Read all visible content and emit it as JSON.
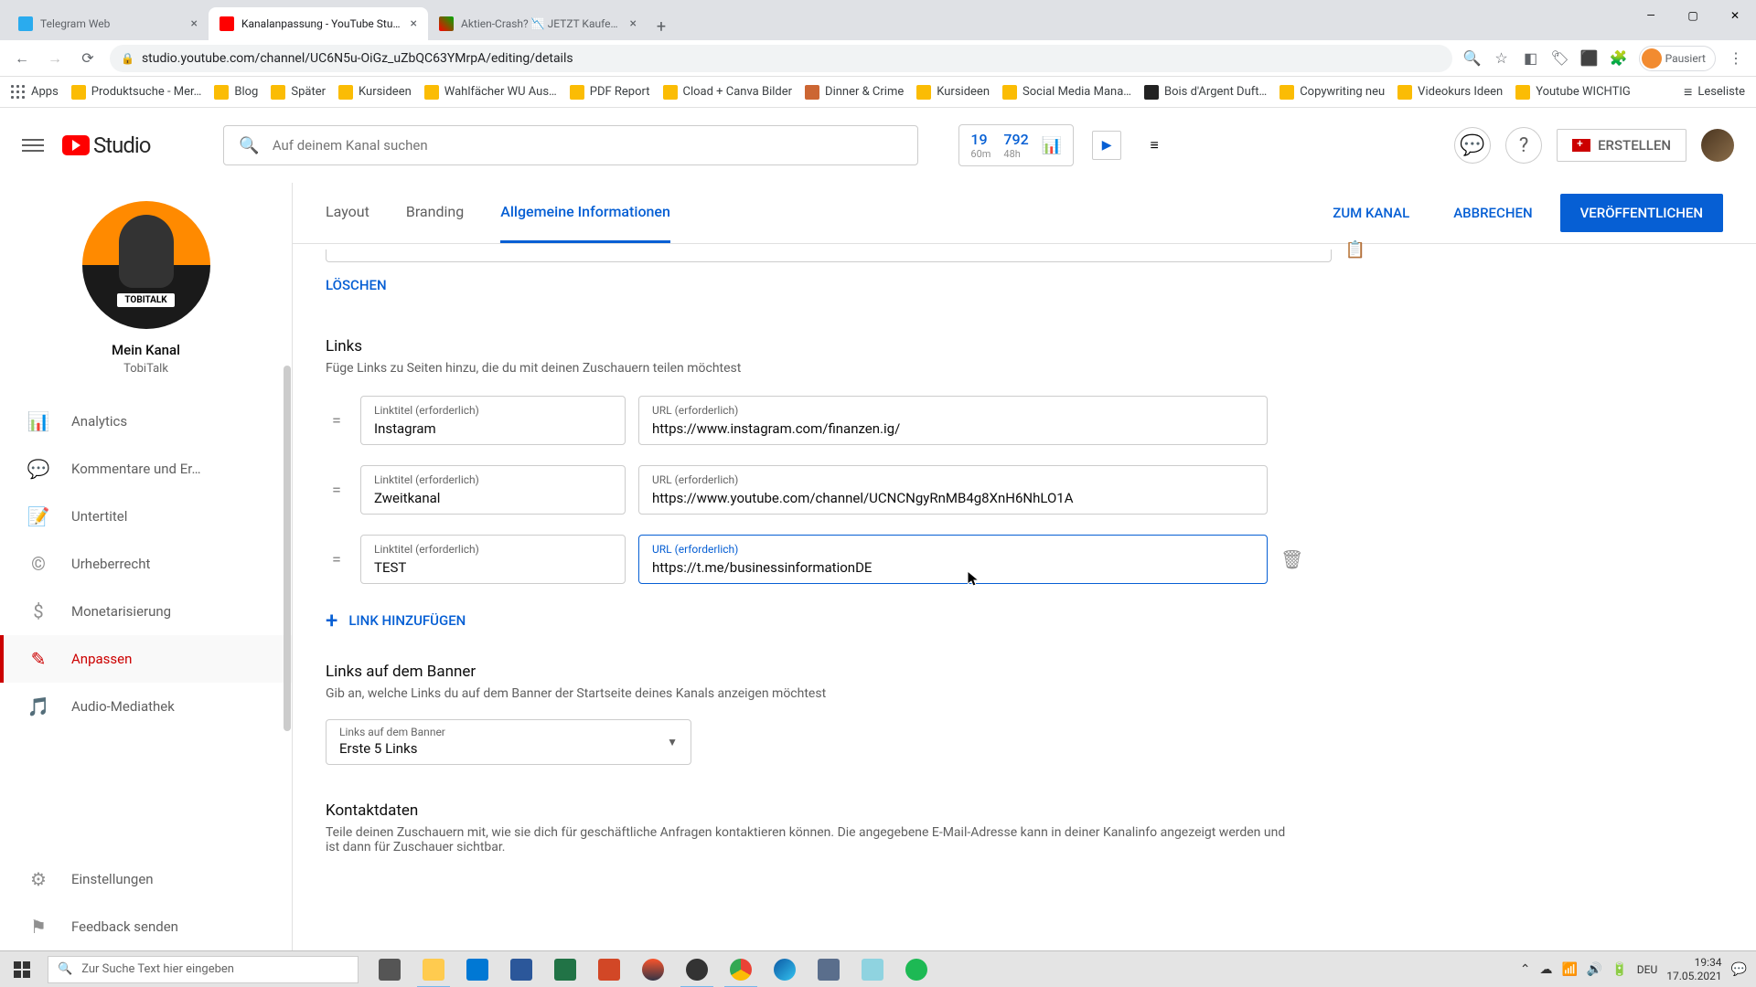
{
  "browser": {
    "tabs": [
      {
        "title": "Telegram Web",
        "active": false
      },
      {
        "title": "Kanalanpassung - YouTube Studio",
        "active": true
      },
      {
        "title": "Aktien-Crash? 📉 JETZT Kaufen o…",
        "active": false
      }
    ],
    "url": "studio.youtube.com/channel/UC6N5u-OiGz_uZbQC63YMrpA/editing/details",
    "profile_label": "Pausiert",
    "bookmarks": [
      "Apps",
      "Produktsuche - Mer…",
      "Blog",
      "Später",
      "Kursideen",
      "Wahlfächer WU Aus…",
      "PDF Report",
      "Cload + Canva Bilder",
      "Dinner & Crime",
      "Kursideen",
      "Social Media Mana…",
      "Bois d'Argent Duft…",
      "Copywriting neu",
      "Videokurs Ideen",
      "Youtube WICHTIG"
    ],
    "bookmarks_right": "Leseliste"
  },
  "header": {
    "logo": "Studio",
    "search_placeholder": "Auf deinem Kanal suchen",
    "stat1_num": "19",
    "stat1_lbl": "60m",
    "stat2_num": "792",
    "stat2_lbl": "48h",
    "create": "ERSTELLEN"
  },
  "sidebar": {
    "channel_name": "Mein Kanal",
    "channel_handle": "TobiTalk",
    "channel_badge": "TOBITALK",
    "items": [
      {
        "icon": "📊",
        "label": "Analytics"
      },
      {
        "icon": "💬",
        "label": "Kommentare und Er…"
      },
      {
        "icon": "📝",
        "label": "Untertitel"
      },
      {
        "icon": "©",
        "label": "Urheberrecht"
      },
      {
        "icon": "$",
        "label": "Monetarisierung"
      },
      {
        "icon": "✎",
        "label": "Anpassen"
      },
      {
        "icon": "🎵",
        "label": "Audio-Mediathek"
      }
    ],
    "footer": [
      {
        "icon": "⚙",
        "label": "Einstellungen"
      },
      {
        "icon": "⚑",
        "label": "Feedback senden"
      }
    ]
  },
  "page": {
    "tabs": [
      "Layout",
      "Branding",
      "Allgemeine Informationen"
    ],
    "action_channel": "ZUM KANAL",
    "action_cancel": "ABBRECHEN",
    "action_publish": "VERÖFFENTLICHEN",
    "delete": "LÖSCHEN",
    "links_title": "Links",
    "links_desc": "Füge Links zu Seiten hinzu, die du mit deinen Zuschauern teilen möchtest",
    "fld_title_label": "Linktitel (erforderlich)",
    "fld_url_label": "URL (erforderlich)",
    "links": [
      {
        "title": "Instagram",
        "url": "https://www.instagram.com/finanzen.ig/"
      },
      {
        "title": "Zweitkanal",
        "url": "https://www.youtube.com/channel/UCNCNgyRnMB4g8XnH6NhLO1A"
      },
      {
        "title": "TEST",
        "url": "https://t.me/businessinformationDE"
      }
    ],
    "add_link": "LINK HINZUFÜGEN",
    "banner_title": "Links auf dem Banner",
    "banner_desc": "Gib an, welche Links du auf dem Banner der Startseite deines Kanals anzeigen möchtest",
    "banner_select_label": "Links auf dem Banner",
    "banner_select_value": "Erste 5 Links",
    "contact_title": "Kontaktdaten",
    "contact_desc": "Teile deinen Zuschauern mit, wie sie dich für geschäftliche Anfragen kontaktieren können. Die angegebene E-Mail-Adresse kann in deiner Kanalinfo angezeigt werden und ist dann für Zuschauer sichtbar."
  },
  "taskbar": {
    "search_placeholder": "Zur Suche Text hier eingeben",
    "lang": "DEU",
    "time": "19:34",
    "date": "17.05.2021"
  }
}
